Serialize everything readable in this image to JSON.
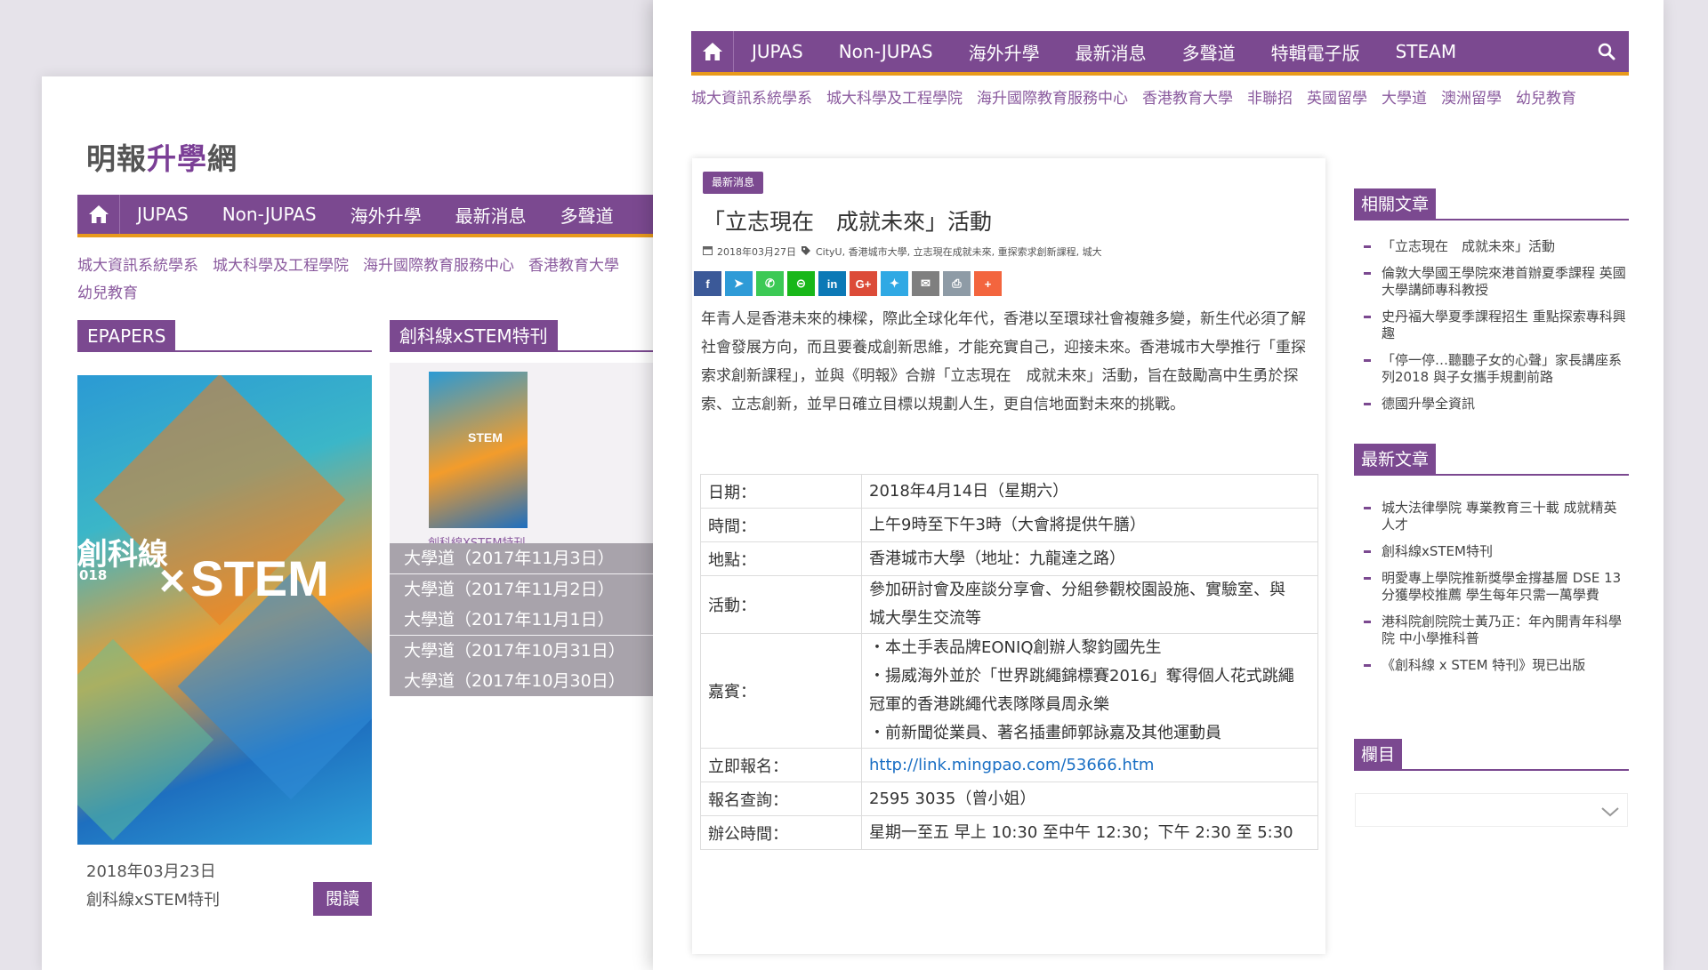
{
  "back": {
    "logo_text": "明報",
    "logo_accent": "升學",
    "logo_tail": "網",
    "nav": [
      "JUPAS",
      "Non-JUPAS",
      "海外升學",
      "最新消息",
      "多聲道"
    ],
    "links": [
      "城大資訊系統學系",
      "城大科學及工程學院",
      "海升國際教育服務中心",
      "香港教育大學",
      "幼兒教育"
    ],
    "epapers_title": "EPAPERS",
    "stem_title": "創科線xSTEM特刊",
    "cover": {
      "line1": "創科線",
      "line2": "018",
      "line3": "STEM",
      "x": "×"
    },
    "cover_small_text": "STEM",
    "cover_small_caption": "創科線XSTEM特刊",
    "archives": [
      "大學道（2017年11月3日）",
      "大學道（2017年11月2日）",
      "大學道（2017年11月1日）",
      "大學道（2017年10月31日）",
      "大學道（2017年10月30日）"
    ],
    "epaper_date": "2018年03月23日",
    "epaper_name": "創科線xSTEM特刊",
    "read_label": "閱讀"
  },
  "front": {
    "nav": [
      "JUPAS",
      "Non-JUPAS",
      "海外升學",
      "最新消息",
      "多聲道",
      "特輯電子版",
      "STEAM"
    ],
    "links": [
      "城大資訊系統學系",
      "城大科學及工程學院",
      "海升國際教育服務中心",
      "香港教育大學",
      "非聯招",
      "英國留學",
      "大學道",
      "澳洲留學",
      "幼兒教育"
    ],
    "article": {
      "tag": "最新消息",
      "title": "「立志現在　成就未來」活動",
      "date": "2018年03月27日",
      "tags_text": "CityU, 香港城市大學, 立志現在成就未來, 重探索求創新課程, 城大",
      "intro": "年青人是香港未來的棟樑，際此全球化年代，香港以至環球社會複雜多變，新生代必須了解社會發展方向，而且要養成創新思維，才能充實自己，迎接未來。香港城市大學推行「重探索求創新課程」，並與《明報》合辦「立志現在　成就未來」活動，旨在鼓勵高中生勇於探索、立志創新，並早日確立目標以規劃人生，更自信地面對未來的挑戰。",
      "share": [
        {
          "icon": "facebook-icon",
          "glyph": "f",
          "color": "#3b5998"
        },
        {
          "icon": "telegram-icon",
          "glyph": "➤",
          "color": "#2f9bd7"
        },
        {
          "icon": "whatsapp-icon",
          "glyph": "✆",
          "color": "#3cc955"
        },
        {
          "icon": "line-icon",
          "glyph": "⊝",
          "color": "#19b71a"
        },
        {
          "icon": "linkedin-icon",
          "glyph": "in",
          "color": "#0c79b6"
        },
        {
          "icon": "googleplus-icon",
          "glyph": "G+",
          "color": "#dc4b38"
        },
        {
          "icon": "twitter-icon",
          "glyph": "✦",
          "color": "#30a9e4"
        },
        {
          "icon": "email-icon",
          "glyph": "✉",
          "color": "#7f7f7f"
        },
        {
          "icon": "print-icon",
          "glyph": "⎙",
          "color": "#8e9ba6"
        },
        {
          "icon": "more-icon",
          "glyph": "+",
          "color": "#f3653e"
        }
      ],
      "info": [
        {
          "key": "日期：",
          "lines": [
            "2018年4月14日（星期六）"
          ]
        },
        {
          "key": "時間：",
          "lines": [
            "上午9時至下午3時（大會將提供午膳）"
          ]
        },
        {
          "key": "地點：",
          "lines": [
            "香港城市大學（地址：九龍達之路）"
          ]
        },
        {
          "key": "活動：",
          "lines": [
            "參加研討會及座談分享會、分組參觀校園設施、實驗室、與",
            "城大學生交流等"
          ]
        },
        {
          "key": "嘉賓：",
          "lines": [
            "・本土手表品牌EONIQ創辦人黎鈞國先生",
            "・揚威海外並於「世界跳繩錦標賽2016」奪得個人花式跳繩",
            "冠軍的香港跳繩代表隊隊員周永樂",
            "・前新聞從業員、著名插畫師郭詠嘉及其他運動員"
          ]
        },
        {
          "key": "立即報名：",
          "lines": [
            "http://link.mingpao.com/53666.htm"
          ]
        },
        {
          "key": "報名查詢：",
          "lines": [
            "2595 3035（曾小姐）"
          ]
        },
        {
          "key": "辦公時間：",
          "lines": [
            "星期一至五 早上 10:30 至中午 12:30；下午 2:30 至 5:30"
          ]
        }
      ]
    },
    "sidebar": {
      "related_title": "相關文章",
      "related": [
        "「立志現在　成就未來」活動",
        "倫敦大學國王學院來港首辦夏季課程 英國大學講師專科教授",
        "史丹福大學夏季課程招生 重點探索專科興趣",
        "「停一停…聽聽子女的心聲」家長講座系列2018 與子女攜手規劃前路",
        "德國升學全資訊"
      ],
      "latest_title": "最新文章",
      "latest": [
        "城大法律學院 專業教育三十載 成就精英人才",
        "創科線xSTEM特刊",
        "明愛專上學院推新獎學金撐基層 DSE 13分獲學校推薦 學生每年只需一萬學費",
        "港科院創院院士黃乃正：年內開青年科學院 中小學推科普",
        "《創科線 x STEM 特刊》現已出版"
      ],
      "column_title": "欄目"
    }
  }
}
